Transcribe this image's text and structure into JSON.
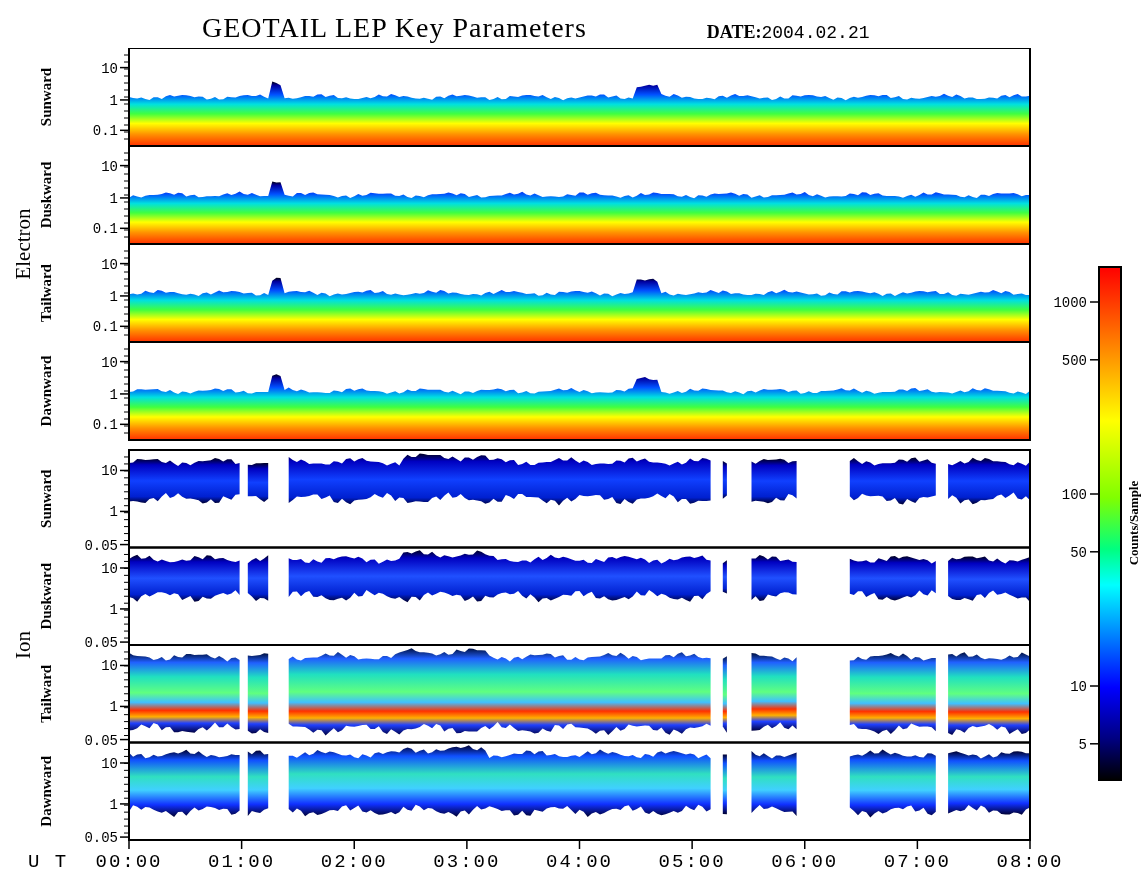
{
  "title": "GEOTAIL LEP Key Parameters",
  "date": "**DATE:**2004.02.21",
  "groups": [
    {
      "label": "Electron",
      "kind": "electron",
      "panels": [
        {
          "label": "Sunward",
          "yticks": [
            "10",
            "1",
            "0.1"
          ]
        },
        {
          "label": "Duskward",
          "yticks": [
            "10",
            "1",
            "0.1"
          ]
        },
        {
          "label": "Tailward",
          "yticks": [
            "10",
            "1",
            "0.1"
          ]
        },
        {
          "label": "Dawnward",
          "yticks": [
            "10",
            "1",
            "0.1"
          ]
        }
      ]
    },
    {
      "label": "Ion",
      "kind": "ion",
      "panels": [
        {
          "label": "Sunward",
          "yticks": [
            "10",
            "1",
            "0.05"
          ]
        },
        {
          "label": "Duskward",
          "yticks": [
            "10",
            "1",
            "0.05"
          ]
        },
        {
          "label": "Tailward",
          "yticks": [
            "10",
            "1",
            "0.05"
          ]
        },
        {
          "label": "Dawnward",
          "yticks": [
            "10",
            "1",
            "0.05"
          ]
        }
      ]
    }
  ],
  "colorbar": {
    "label": "Counts/Sample",
    "ticks": [
      "1000",
      "500",
      "100",
      "50",
      "10",
      "5"
    ]
  },
  "time_axis": {
    "label": "U T",
    "ticks": [
      "00:00",
      "01:00",
      "02:00",
      "03:00",
      "04:00",
      "05:00",
      "06:00",
      "07:00",
      "08:00"
    ]
  }
}
